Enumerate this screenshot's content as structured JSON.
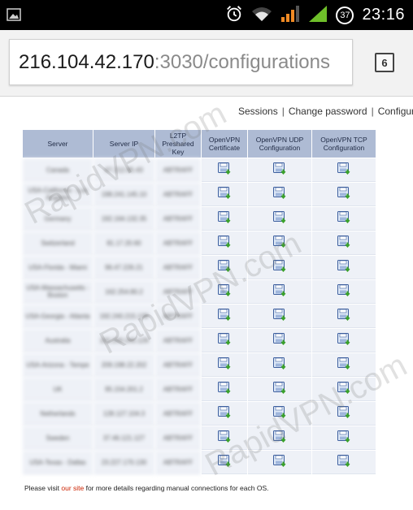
{
  "status_bar": {
    "time": "23:16",
    "notification_badge": "37",
    "icons": [
      "image-notification-icon",
      "alarm-icon",
      "wifi-icon",
      "signal-icon",
      "signal-icon"
    ]
  },
  "browser": {
    "url_host": "216.104.42.170",
    "url_port": ":3030",
    "url_path": "/configurations",
    "tab_count": "6"
  },
  "nav": {
    "sessions": "Sessions",
    "change_password": "Change password",
    "configurations": "Configurations"
  },
  "table": {
    "headers": [
      "Server",
      "Server IP",
      "L2TP Preshared Key",
      "OpenVPN Certificate",
      "OpenVPN UDP Configuration",
      "OpenVPN TCP Configuration"
    ],
    "rows": [
      {
        "server": "Canada",
        "ip": "67.212.85.43",
        "key": "ABTRAFF"
      },
      {
        "server": "USA-California - Los Angeles",
        "ip": "198.241.145.10",
        "key": "ABTRAFF"
      },
      {
        "server": "Germany",
        "ip": "192.164.132.35",
        "key": "ABTRAFF"
      },
      {
        "server": "Switzerland",
        "ip": "81.17.20.60",
        "key": "ABTRAFF"
      },
      {
        "server": "USA-Florida - Miami",
        "ip": "96.47.226.21",
        "key": "ABTRAFF"
      },
      {
        "server": "USA-Massachusetts - Boston",
        "ip": "162.254.80.2",
        "key": "ABTRAFF"
      },
      {
        "server": "USA-Georgia - Atlanta",
        "ip": "192.240.215.138",
        "key": "ABTRAFF"
      },
      {
        "server": "Australia",
        "ip": "192.200.245.129",
        "key": "ABTRAFF"
      },
      {
        "server": "USA-Arizona - Tempe",
        "ip": "209.198.22.202",
        "key": "ABTRAFF"
      },
      {
        "server": "UK",
        "ip": "95.154.201.2",
        "key": "ABTRAFF"
      },
      {
        "server": "Netherlands",
        "ip": "128.127.104.3",
        "key": "ABTRAFF"
      },
      {
        "server": "Sweden",
        "ip": "37.46.121.127",
        "key": "ABTRAFF"
      },
      {
        "server": "USA-Texas - Dallas",
        "ip": "23.227.170.130",
        "key": "ABTRAFF"
      }
    ]
  },
  "footer": {
    "before": "Please visit ",
    "link": "our site",
    "after": " for more details regarding manual connections for each OS."
  },
  "watermark": "RapidVPN.com",
  "colors": {
    "header_bg": "#aebbd4",
    "row_bg": "#eef1f7",
    "link_red": "#cc2200",
    "signal_orange": "#f08a24",
    "signal_green": "#6fbf2a"
  }
}
